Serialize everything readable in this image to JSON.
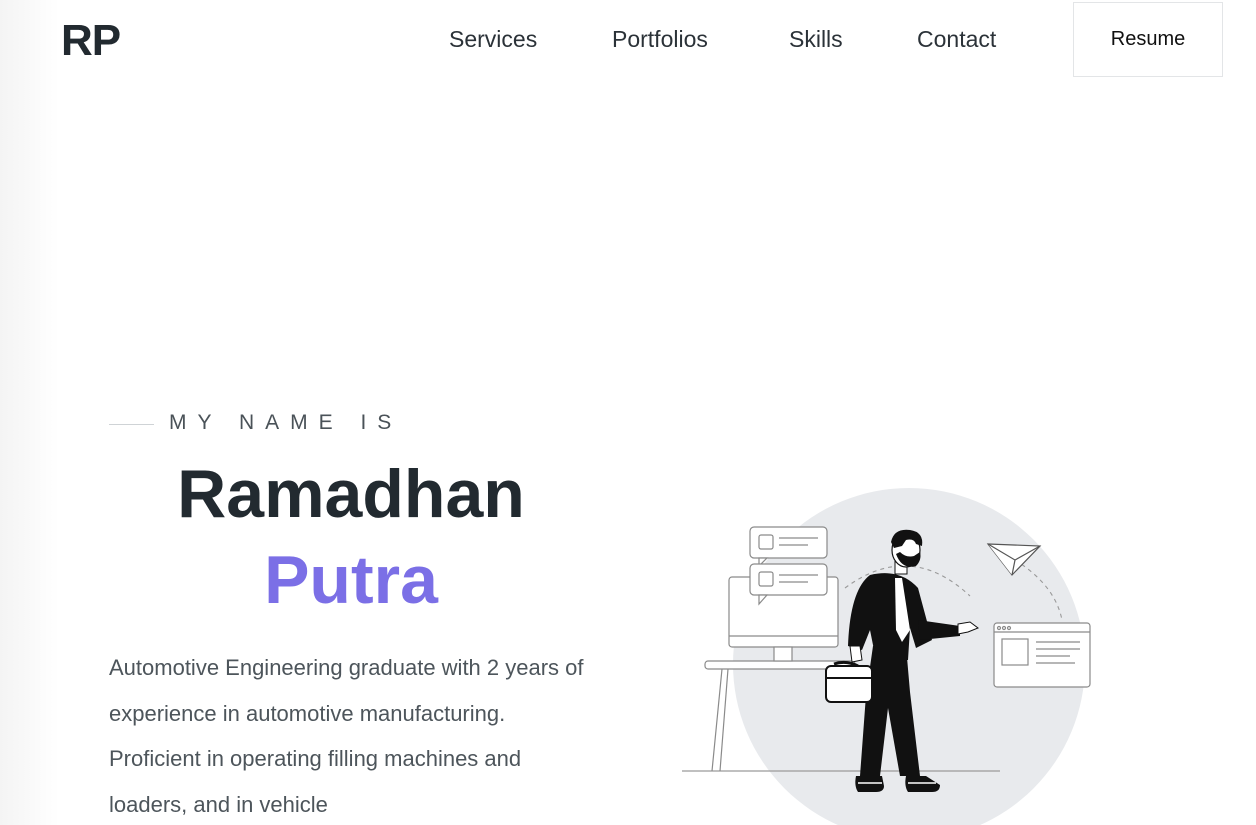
{
  "header": {
    "logo": "RP",
    "nav": [
      "Services",
      "Portfolios",
      "Skills",
      "Contact"
    ],
    "resume_label": "Resume"
  },
  "hero": {
    "eyebrow": "MY NAME IS",
    "first_name": "Ramadhan",
    "last_name": "Putra",
    "bio": "Automotive Engineering graduate with 2 years of experience in automotive manufacturing. Proficient in operating filling machines and loaders, and in vehicle",
    "accent_color": "#7b6fe6",
    "illustration": "man-with-briefcase-illustration"
  }
}
